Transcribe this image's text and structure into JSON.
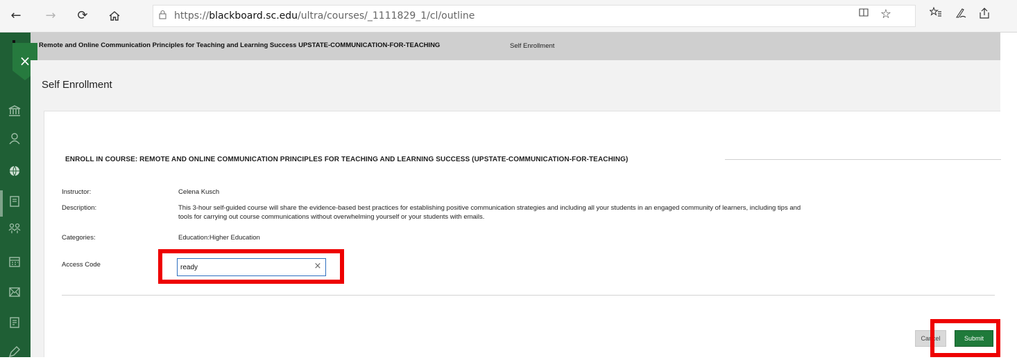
{
  "browser": {
    "url_prefix": "https://",
    "url_host": "blackboard.sc.edu",
    "url_path": "/ultra/courses/_1111829_1/cl/outline"
  },
  "breadcrumb": {
    "course": "Remote and Online Communication Principles for Teaching and Learning Success UPSTATE-COMMUNICATION-FOR-TEACHING",
    "current": "Self Enrollment"
  },
  "page": {
    "title": "Self Enrollment",
    "section_title": "ENROLL IN COURSE: REMOTE AND ONLINE COMMUNICATION PRINCIPLES FOR TEACHING AND LEARNING SUCCESS (UPSTATE-COMMUNICATION-FOR-TEACHING)"
  },
  "form": {
    "instructor_label": "Instructor:",
    "instructor_value": "Celena Kusch",
    "description_label": "Description:",
    "description_line1": "This 3-hour self-guided course will share the evidence-based best practices for establishing positive communication strategies and including all your students in an engaged community of learners, including tips and",
    "description_line2": "tools for carrying out course communications without overwhelming yourself or your students with emails.",
    "categories_label": "Categories:",
    "categories_value": "Education:Higher Education",
    "access_code_label": "Access Code",
    "access_code_value": "ready"
  },
  "buttons": {
    "cancel": "Cancel",
    "submit": "Submit"
  },
  "colors": {
    "sidebar": "#1f5f35",
    "submit": "#1f7a3a",
    "highlight": "#ee0000"
  },
  "icons": [
    "back-icon",
    "forward-icon",
    "refresh-icon",
    "home-icon",
    "lock-icon",
    "reading-view-icon",
    "favorite-star-icon",
    "favorites-icon",
    "pen-icon",
    "share-icon",
    "institution-icon",
    "profile-icon",
    "globe-icon",
    "activity-stream-icon",
    "groups-icon",
    "calendar-icon",
    "messages-icon",
    "grades-icon",
    "edit-icon",
    "close-icon"
  ]
}
